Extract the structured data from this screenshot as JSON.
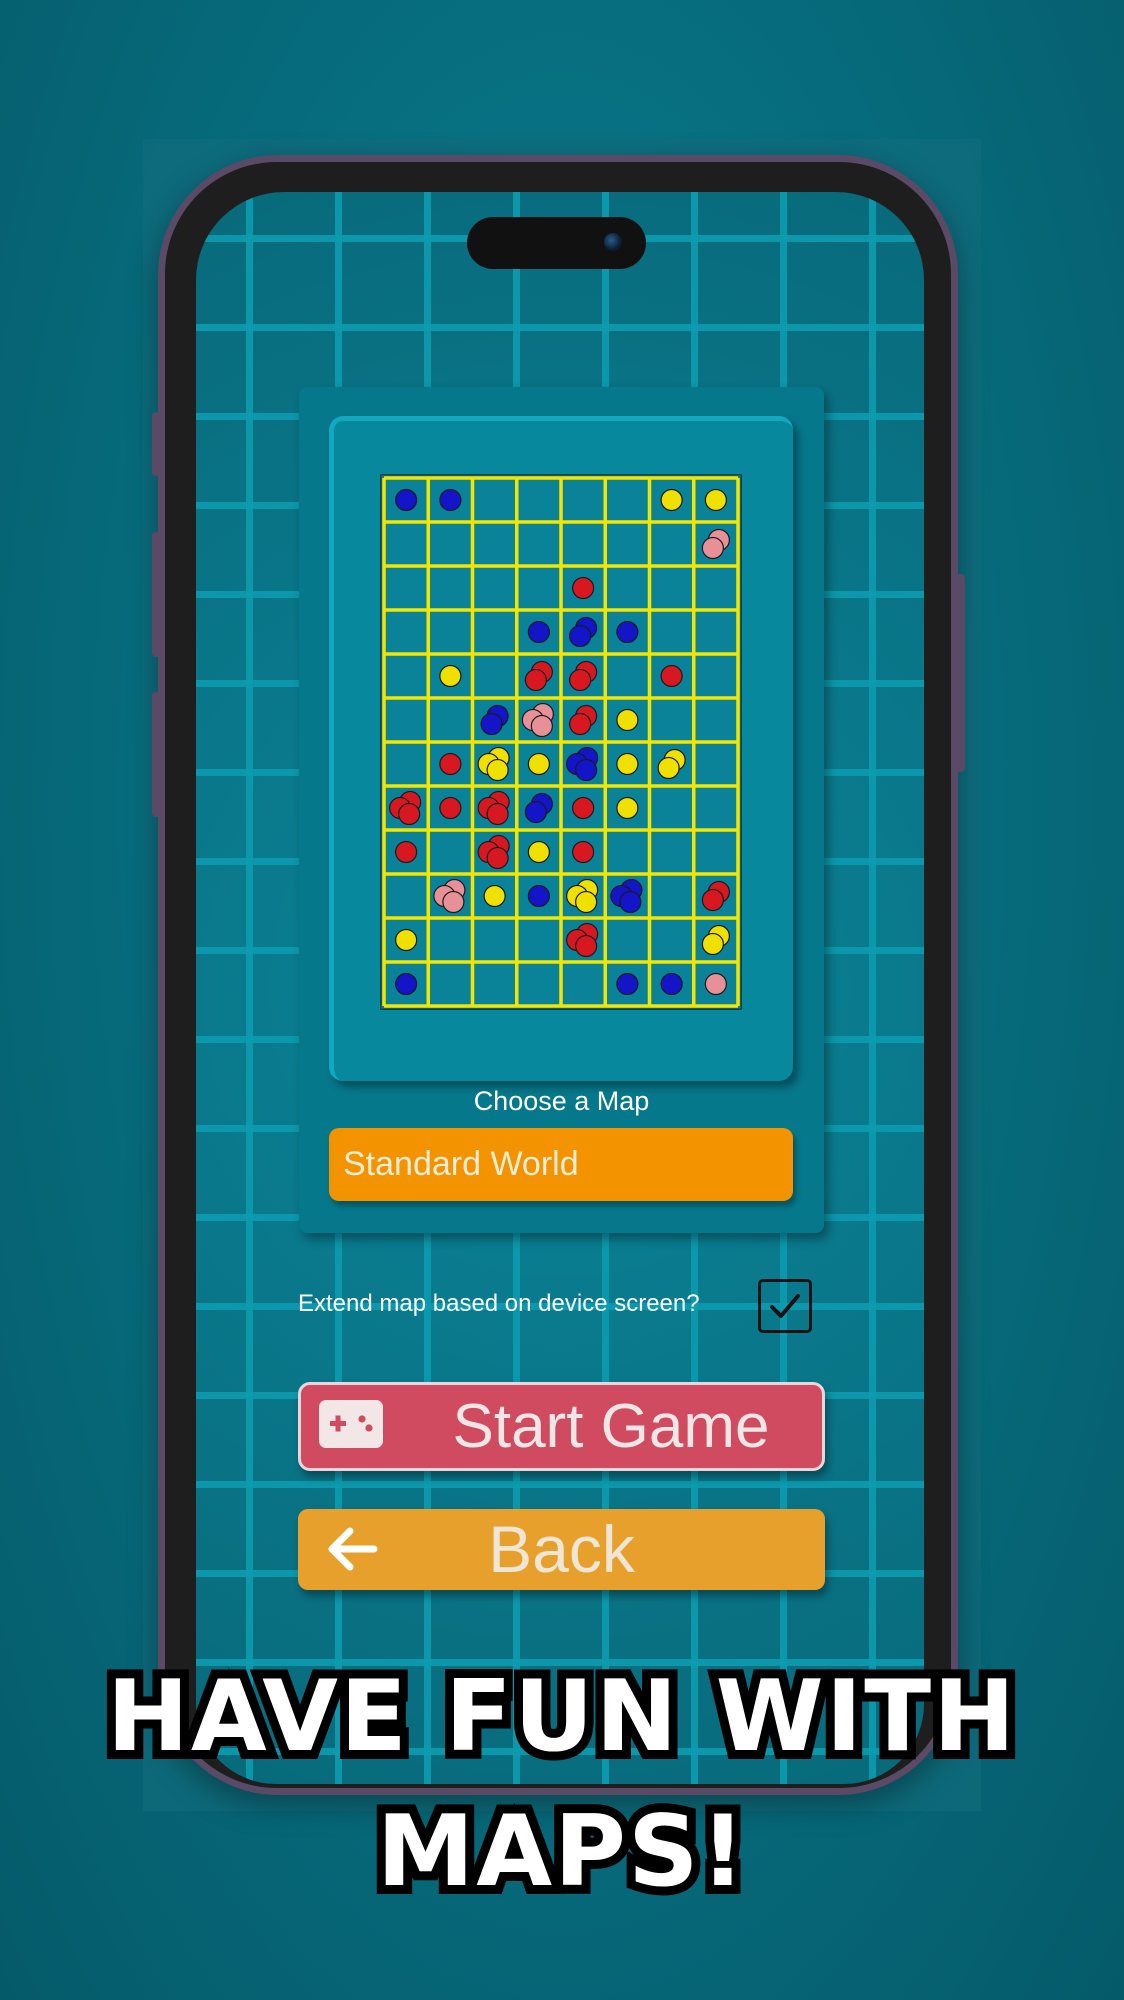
{
  "screen": {
    "choose_map_label": "Choose a Map",
    "selected_map": "Standard World",
    "extend_label": "Extend map based on device screen?",
    "extend_checked": true,
    "start_label": "Start Game",
    "back_label": "Back"
  },
  "icons": {
    "start": "gamepad-icon",
    "back": "arrow-left-icon",
    "check": "checkmark-icon"
  },
  "caption": {
    "line1": "HAVE FUN WITH",
    "line2": "MAPS!"
  },
  "colors": {
    "board_line": "#f2e600",
    "red": "#d81820",
    "blue": "#1414c8",
    "yellow": "#f0e000",
    "pink": "#e89098",
    "select": "#f39300",
    "start": "#d04b5f",
    "back": "#e8a02c"
  },
  "board": {
    "cols": 8,
    "rows": 12,
    "cells": [
      [
        0,
        0,
        "blue",
        1
      ],
      [
        1,
        0,
        "blue",
        1
      ],
      [
        6,
        0,
        "yellow",
        1
      ],
      [
        7,
        0,
        "yellow",
        1
      ],
      [
        7,
        1,
        "pink",
        2
      ],
      [
        4,
        2,
        "red",
        1
      ],
      [
        3,
        3,
        "blue",
        1
      ],
      [
        4,
        3,
        "blue",
        2
      ],
      [
        5,
        3,
        "blue",
        1
      ],
      [
        1,
        4,
        "yellow",
        1
      ],
      [
        3,
        4,
        "red",
        2
      ],
      [
        4,
        4,
        "red",
        2
      ],
      [
        6,
        4,
        "red",
        1
      ],
      [
        2,
        5,
        "blue",
        2
      ],
      [
        3,
        5,
        "pink",
        3
      ],
      [
        4,
        5,
        "red",
        2
      ],
      [
        5,
        5,
        "yellow",
        1
      ],
      [
        1,
        6,
        "red",
        1
      ],
      [
        2,
        6,
        "yellow",
        3
      ],
      [
        3,
        6,
        "yellow",
        1
      ],
      [
        4,
        6,
        "blue",
        3
      ],
      [
        5,
        6,
        "yellow",
        1
      ],
      [
        6,
        6,
        "yellow",
        2
      ],
      [
        0,
        7,
        "red",
        3
      ],
      [
        1,
        7,
        "red",
        1
      ],
      [
        2,
        7,
        "red",
        3
      ],
      [
        3,
        7,
        "blue",
        2
      ],
      [
        4,
        7,
        "red",
        1
      ],
      [
        5,
        7,
        "yellow",
        1
      ],
      [
        0,
        8,
        "red",
        1
      ],
      [
        2,
        8,
        "red",
        3
      ],
      [
        3,
        8,
        "yellow",
        1
      ],
      [
        4,
        8,
        "red",
        1
      ],
      [
        1,
        9,
        "pink",
        3
      ],
      [
        2,
        9,
        "yellow",
        1
      ],
      [
        3,
        9,
        "blue",
        1
      ],
      [
        4,
        9,
        "yellow",
        3
      ],
      [
        5,
        9,
        "blue",
        3
      ],
      [
        7,
        9,
        "red",
        2
      ],
      [
        0,
        10,
        "yellow",
        1
      ],
      [
        4,
        10,
        "red",
        3
      ],
      [
        7,
        10,
        "yellow",
        2
      ],
      [
        0,
        11,
        "blue",
        1
      ],
      [
        5,
        11,
        "blue",
        1
      ],
      [
        6,
        11,
        "blue",
        1
      ],
      [
        7,
        11,
        "pink",
        1
      ]
    ]
  }
}
